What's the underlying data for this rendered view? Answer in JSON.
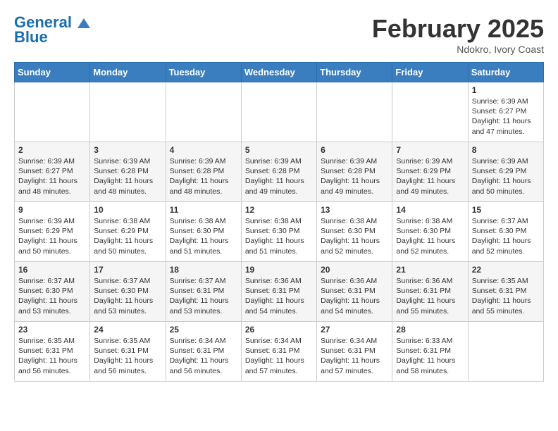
{
  "header": {
    "logo_line1": "General",
    "logo_line2": "Blue",
    "month": "February 2025",
    "location": "Ndokro, Ivory Coast"
  },
  "days_of_week": [
    "Sunday",
    "Monday",
    "Tuesday",
    "Wednesday",
    "Thursday",
    "Friday",
    "Saturday"
  ],
  "weeks": [
    [
      {
        "day": "",
        "info": ""
      },
      {
        "day": "",
        "info": ""
      },
      {
        "day": "",
        "info": ""
      },
      {
        "day": "",
        "info": ""
      },
      {
        "day": "",
        "info": ""
      },
      {
        "day": "",
        "info": ""
      },
      {
        "day": "1",
        "info": "Sunrise: 6:39 AM\nSunset: 6:27 PM\nDaylight: 11 hours\nand 47 minutes."
      }
    ],
    [
      {
        "day": "2",
        "info": "Sunrise: 6:39 AM\nSunset: 6:27 PM\nDaylight: 11 hours\nand 48 minutes."
      },
      {
        "day": "3",
        "info": "Sunrise: 6:39 AM\nSunset: 6:28 PM\nDaylight: 11 hours\nand 48 minutes."
      },
      {
        "day": "4",
        "info": "Sunrise: 6:39 AM\nSunset: 6:28 PM\nDaylight: 11 hours\nand 48 minutes."
      },
      {
        "day": "5",
        "info": "Sunrise: 6:39 AM\nSunset: 6:28 PM\nDaylight: 11 hours\nand 49 minutes."
      },
      {
        "day": "6",
        "info": "Sunrise: 6:39 AM\nSunset: 6:28 PM\nDaylight: 11 hours\nand 49 minutes."
      },
      {
        "day": "7",
        "info": "Sunrise: 6:39 AM\nSunset: 6:29 PM\nDaylight: 11 hours\nand 49 minutes."
      },
      {
        "day": "8",
        "info": "Sunrise: 6:39 AM\nSunset: 6:29 PM\nDaylight: 11 hours\nand 50 minutes."
      }
    ],
    [
      {
        "day": "9",
        "info": "Sunrise: 6:39 AM\nSunset: 6:29 PM\nDaylight: 11 hours\nand 50 minutes."
      },
      {
        "day": "10",
        "info": "Sunrise: 6:38 AM\nSunset: 6:29 PM\nDaylight: 11 hours\nand 50 minutes."
      },
      {
        "day": "11",
        "info": "Sunrise: 6:38 AM\nSunset: 6:30 PM\nDaylight: 11 hours\nand 51 minutes."
      },
      {
        "day": "12",
        "info": "Sunrise: 6:38 AM\nSunset: 6:30 PM\nDaylight: 11 hours\nand 51 minutes."
      },
      {
        "day": "13",
        "info": "Sunrise: 6:38 AM\nSunset: 6:30 PM\nDaylight: 11 hours\nand 52 minutes."
      },
      {
        "day": "14",
        "info": "Sunrise: 6:38 AM\nSunset: 6:30 PM\nDaylight: 11 hours\nand 52 minutes."
      },
      {
        "day": "15",
        "info": "Sunrise: 6:37 AM\nSunset: 6:30 PM\nDaylight: 11 hours\nand 52 minutes."
      }
    ],
    [
      {
        "day": "16",
        "info": "Sunrise: 6:37 AM\nSunset: 6:30 PM\nDaylight: 11 hours\nand 53 minutes."
      },
      {
        "day": "17",
        "info": "Sunrise: 6:37 AM\nSunset: 6:30 PM\nDaylight: 11 hours\nand 53 minutes."
      },
      {
        "day": "18",
        "info": "Sunrise: 6:37 AM\nSunset: 6:31 PM\nDaylight: 11 hours\nand 53 minutes."
      },
      {
        "day": "19",
        "info": "Sunrise: 6:36 AM\nSunset: 6:31 PM\nDaylight: 11 hours\nand 54 minutes."
      },
      {
        "day": "20",
        "info": "Sunrise: 6:36 AM\nSunset: 6:31 PM\nDaylight: 11 hours\nand 54 minutes."
      },
      {
        "day": "21",
        "info": "Sunrise: 6:36 AM\nSunset: 6:31 PM\nDaylight: 11 hours\nand 55 minutes."
      },
      {
        "day": "22",
        "info": "Sunrise: 6:35 AM\nSunset: 6:31 PM\nDaylight: 11 hours\nand 55 minutes."
      }
    ],
    [
      {
        "day": "23",
        "info": "Sunrise: 6:35 AM\nSunset: 6:31 PM\nDaylight: 11 hours\nand 56 minutes."
      },
      {
        "day": "24",
        "info": "Sunrise: 6:35 AM\nSunset: 6:31 PM\nDaylight: 11 hours\nand 56 minutes."
      },
      {
        "day": "25",
        "info": "Sunrise: 6:34 AM\nSunset: 6:31 PM\nDaylight: 11 hours\nand 56 minutes."
      },
      {
        "day": "26",
        "info": "Sunrise: 6:34 AM\nSunset: 6:31 PM\nDaylight: 11 hours\nand 57 minutes."
      },
      {
        "day": "27",
        "info": "Sunrise: 6:34 AM\nSunset: 6:31 PM\nDaylight: 11 hours\nand 57 minutes."
      },
      {
        "day": "28",
        "info": "Sunrise: 6:33 AM\nSunset: 6:31 PM\nDaylight: 11 hours\nand 58 minutes."
      },
      {
        "day": "",
        "info": ""
      }
    ]
  ]
}
